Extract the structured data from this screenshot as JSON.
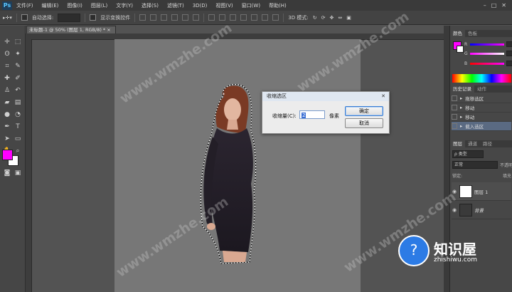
{
  "app_logo": "Ps",
  "menu": [
    "文件(F)",
    "编辑(E)",
    "图像(I)",
    "图层(L)",
    "文字(Y)",
    "选择(S)",
    "滤镜(T)",
    "3D(D)",
    "视图(V)",
    "窗口(W)",
    "帮助(H)"
  ],
  "window_controls": [
    "–",
    "□",
    "✕"
  ],
  "options": {
    "auto_select_label": "自动选择:",
    "transform_label": "显示变换控件",
    "mode_3d_label": "3D 模式:"
  },
  "document_tab": "未标题-1 @ 50% (图层 1, RGB/8) *",
  "document_tab_close": "×",
  "dialog": {
    "title": "收缩选区",
    "close": "✕",
    "label": "收缩量(C):",
    "value": "2",
    "unit": "像素",
    "ok": "确定",
    "cancel": "取消"
  },
  "color_panel": {
    "tabs": [
      "颜色",
      "色板"
    ],
    "channels": [
      "R",
      "G",
      "B"
    ],
    "fg_color": "#ff00ff"
  },
  "history_panel": {
    "tabs": [
      "历史记录",
      "动作"
    ],
    "items": [
      "拖移选区",
      "移动",
      "移动",
      "载入选区"
    ],
    "active_index": 3
  },
  "layers_panel": {
    "tabs": [
      "图层",
      "通道",
      "路径"
    ],
    "filter_label": "ρ 类型",
    "blend_mode": "正常",
    "opacity_label": "不透明",
    "lock_label": "锁定:",
    "fill_label": "填充",
    "layers": [
      {
        "name": "图层 1",
        "italic": false
      },
      {
        "name": "背景",
        "italic": true
      }
    ]
  },
  "watermark": "www.wmzhe.com",
  "brand": {
    "name": "知识屋",
    "url": "zhishiwu.com"
  }
}
